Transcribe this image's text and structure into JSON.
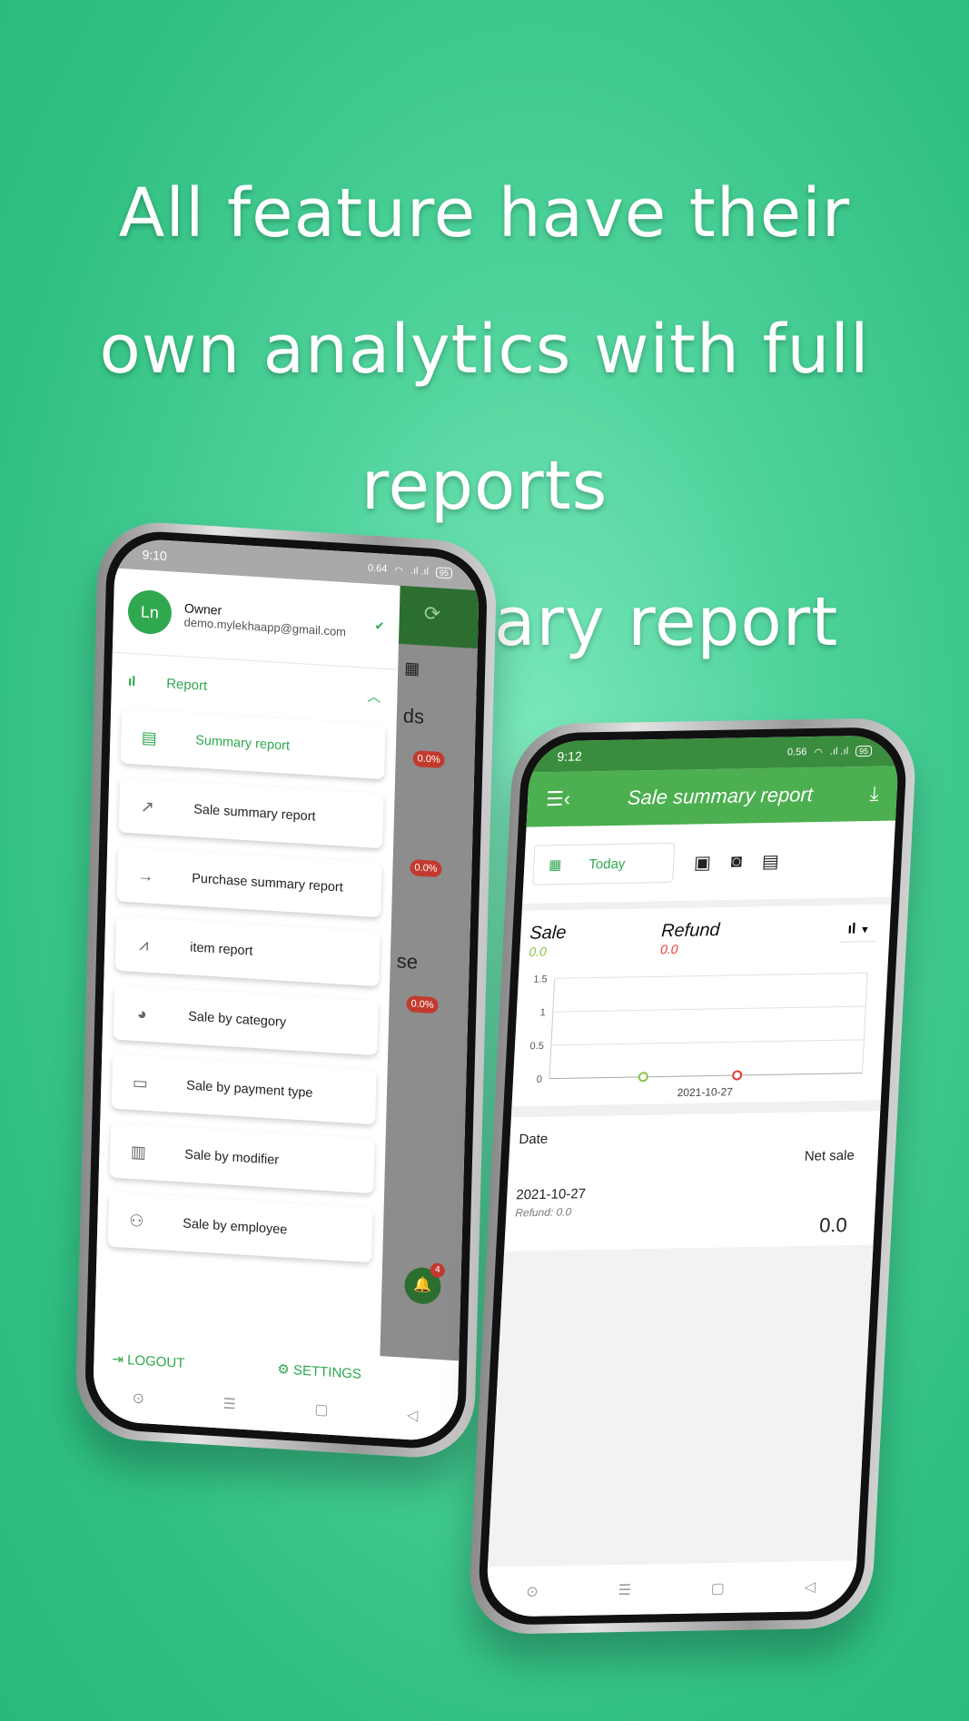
{
  "headline": {
    "line1": "All feature have their",
    "line2": "own analytics with full reports",
    "line3": "and summary report"
  },
  "phone_left": {
    "status": {
      "time": "9:10",
      "speed": "0.64",
      "battery": "95"
    },
    "profile": {
      "name": "Owner",
      "email": "demo.mylekhaapp@gmail.com"
    },
    "report_label": "Report",
    "menu": [
      {
        "label": "Summary report",
        "icon": "document-icon",
        "active": true
      },
      {
        "label": "Sale summary report",
        "icon": "trending-up-icon"
      },
      {
        "label": "Purchase summary report",
        "icon": "arrow-right-icon"
      },
      {
        "label": "item report",
        "icon": "area-chart-icon"
      },
      {
        "label": "Sale by category",
        "icon": "pie-chart-icon"
      },
      {
        "label": "Sale by payment type",
        "icon": "credit-card-icon"
      },
      {
        "label": "Sale by modifier",
        "icon": "bar-chart-box-icon"
      },
      {
        "label": "Sale by employee",
        "icon": "person-check-icon"
      }
    ],
    "logout": "LOGOUT",
    "settings": "SETTINGS",
    "background": {
      "frag1": "ds",
      "frag2": "se",
      "pct": "0.0%",
      "bell_count": "4"
    }
  },
  "phone_right": {
    "status": {
      "time": "9:12",
      "speed": "0.56",
      "battery": "95"
    },
    "title": "Sale summary report",
    "filter": "Today",
    "sale_label": "Sale",
    "sale_value": "0.0",
    "refund_label": "Refund",
    "refund_value": "0.0",
    "colors": {
      "sale": "#8bc34a",
      "refund": "#e53935",
      "brand": "#4caf50"
    },
    "chart_data": {
      "type": "line",
      "categories": [
        "2021-10-27"
      ],
      "yticks": [
        "1.5",
        "1",
        "0.5",
        "0"
      ],
      "ylim": [
        0,
        1.5
      ],
      "series": [
        {
          "name": "Sale",
          "values": [
            0
          ]
        },
        {
          "name": "Refund",
          "values": [
            0
          ]
        }
      ]
    },
    "table": {
      "col_date": "Date",
      "col_net": "Net sale",
      "rows": [
        {
          "date": "2021-10-27",
          "refund": "Refund: 0.0",
          "net": "0.0"
        }
      ]
    }
  }
}
